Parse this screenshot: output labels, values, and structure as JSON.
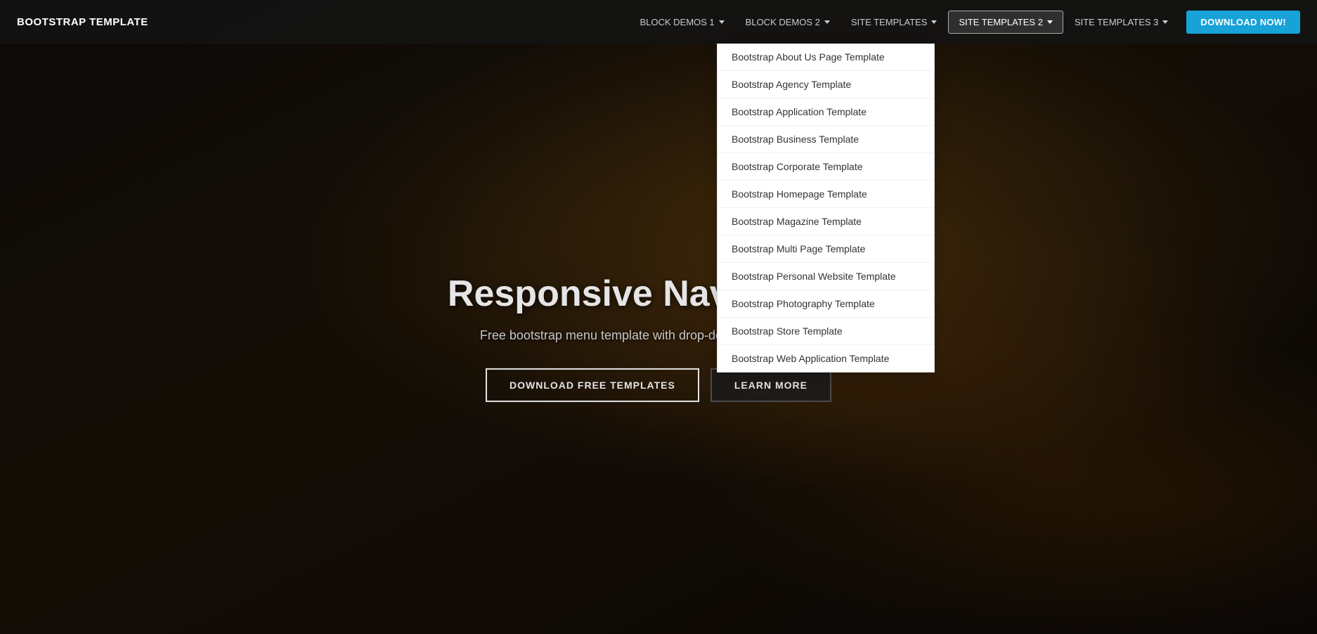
{
  "brand": "BOOTSTRAP TEMPLATE",
  "nav": {
    "items": [
      {
        "id": "block-demos-1",
        "label": "BLOCK DEMOS 1",
        "hasDropdown": true
      },
      {
        "id": "block-demos-2",
        "label": "BLOCK DEMOS 2",
        "hasDropdown": true
      },
      {
        "id": "site-templates",
        "label": "SITE TEMPLATES",
        "hasDropdown": true
      },
      {
        "id": "site-templates-2",
        "label": "SITE TEMPLATES 2",
        "hasDropdown": true,
        "active": true
      },
      {
        "id": "site-templates-3",
        "label": "SITE TEMPLATES 3",
        "hasDropdown": true
      }
    ],
    "download_label": "DOWNLOAD NOW!"
  },
  "hero": {
    "title": "Responsive Navbar Tem",
    "subtitle": "Free bootstrap menu template with drop-down lists and buttons.",
    "btn1_label": "DOWNLOAD FREE TEMPLATES",
    "btn2_label": "LEARN MORE"
  },
  "dropdown": {
    "items": [
      "Bootstrap About Us Page Template",
      "Bootstrap Agency Template",
      "Bootstrap Application Template",
      "Bootstrap Business Template",
      "Bootstrap Corporate Template",
      "Bootstrap Homepage Template",
      "Bootstrap Magazine Template",
      "Bootstrap Multi Page Template",
      "Bootstrap Personal Website Template",
      "Bootstrap Photography Template",
      "Bootstrap Store Template",
      "Bootstrap Web Application Template"
    ]
  }
}
